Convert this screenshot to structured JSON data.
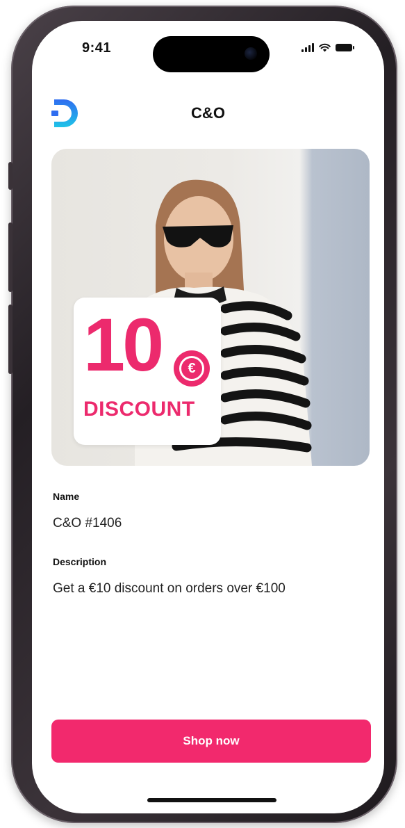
{
  "status_bar": {
    "time": "9:41"
  },
  "header": {
    "title": "C&O",
    "logo_icon": "brand-logo-icon"
  },
  "hero": {
    "discount_amount": "10",
    "currency_symbol": "€",
    "discount_word": "DISCOUNT"
  },
  "details": {
    "name_label": "Name",
    "name_value": "C&O #1406",
    "description_label": "Description",
    "description_value": "Get a €10 discount on orders over €100"
  },
  "actions": {
    "shop_label": "Shop now"
  },
  "colors": {
    "accent": "#f2296d",
    "discount_pink": "#ec2a6d",
    "logo_blue": "#2f6df0",
    "logo_cyan": "#1ec4e8"
  }
}
